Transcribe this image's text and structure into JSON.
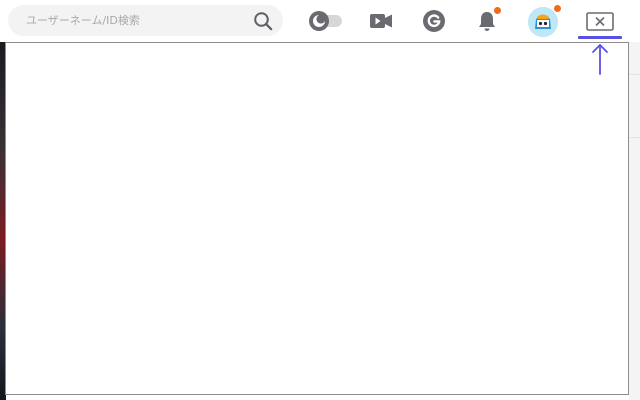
{
  "search": {
    "placeholder": "ユーザーネーム/ID検索"
  },
  "toolbar": {
    "icons": [
      {
        "name": "search-icon"
      },
      {
        "name": "dark-mode-toggle-icon"
      },
      {
        "name": "video-camera-icon"
      },
      {
        "name": "g-coin-icon"
      },
      {
        "name": "bell-icon"
      },
      {
        "name": "user-avatar"
      },
      {
        "name": "close-window-icon"
      }
    ],
    "notification_dot_color": "#f26a1b",
    "accent_color": "#5b50e4"
  },
  "panel": {
    "background": "#ffffff"
  }
}
